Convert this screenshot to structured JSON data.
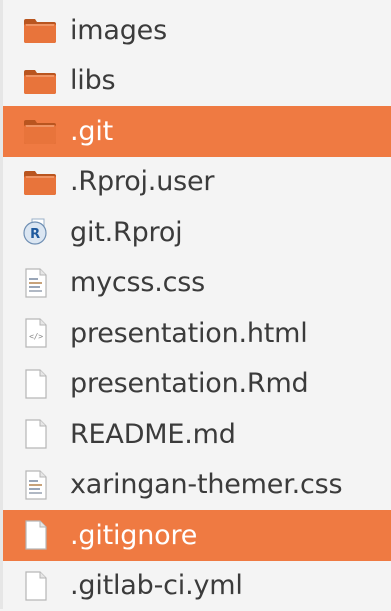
{
  "files": [
    {
      "name": "images",
      "kind": "folder",
      "icon": "folder-icon",
      "selected": false
    },
    {
      "name": "libs",
      "kind": "folder",
      "icon": "folder-icon",
      "selected": false
    },
    {
      "name": ".git",
      "kind": "folder",
      "icon": "folder-icon",
      "selected": true
    },
    {
      "name": ".Rproj.user",
      "kind": "folder",
      "icon": "folder-icon",
      "selected": false
    },
    {
      "name": "git.Rproj",
      "kind": "rproj",
      "icon": "rproj-icon",
      "selected": false
    },
    {
      "name": "mycss.css",
      "kind": "css",
      "icon": "css-file-icon",
      "selected": false
    },
    {
      "name": "presentation.html",
      "kind": "html",
      "icon": "html-file-icon",
      "selected": false
    },
    {
      "name": "presentation.Rmd",
      "kind": "text",
      "icon": "text-file-icon",
      "selected": false
    },
    {
      "name": "README.md",
      "kind": "text",
      "icon": "text-file-icon",
      "selected": false
    },
    {
      "name": "xaringan-themer.css",
      "kind": "css",
      "icon": "css-file-icon",
      "selected": false
    },
    {
      "name": ".gitignore",
      "kind": "text",
      "icon": "text-file-icon",
      "selected": true
    },
    {
      "name": ".gitlab-ci.yml",
      "kind": "text",
      "icon": "text-file-icon",
      "selected": false
    }
  ],
  "colors": {
    "selection": "#ef7a42",
    "folder": "#e8743b",
    "text": "#3b3b3b",
    "background": "#f4f4f4"
  }
}
